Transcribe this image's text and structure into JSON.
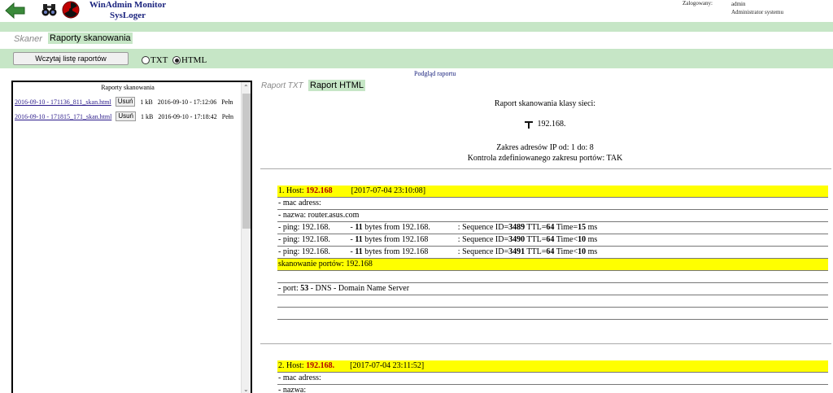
{
  "header": {
    "title_line1": "WinAdmin Monitor",
    "title_line2": "SysLoger",
    "login_label": "Zalogowany:",
    "user": "admin",
    "role": "Administrator systemu"
  },
  "tabs_top": {
    "inactive": "Skaner",
    "active": "Raporty skanowania"
  },
  "toolbar": {
    "load_button": "Wczytaj listę raportów",
    "radio_txt": "TXT",
    "radio_html": "HTML",
    "selected": "HTML"
  },
  "left": {
    "title": "Raporty skanowania",
    "files": [
      {
        "name": "2016-09-10 - 171136_811_skan.html",
        "delete": "Usuń",
        "size": "1 kB",
        "date": "2016-09-10 - 17:12:06",
        "status": "Pełn"
      },
      {
        "name": "2016-09-10 - 171815_171_skan.html",
        "delete": "Usuń",
        "size": "1 kB",
        "date": "2016-09-10 - 17:18:42",
        "status": "Pełn"
      }
    ]
  },
  "right": {
    "preview_label": "Podgląd raportu",
    "tab_txt": "Raport TXT",
    "tab_html": "Raport HTML",
    "report_title": "Raport skanowania klasy sieci:",
    "network": "192.168.",
    "range": "Zakres adresów IP od: 1 do: 8",
    "port_control": "Kontrola zdefiniowanego zakresu portów: TAK",
    "hosts": [
      {
        "label": "1. Host:",
        "ip": "192.168",
        "time": "[2017-07-04 23:10:08]",
        "mac": "- mac adress:",
        "name": "- nazwa: router.asus.com",
        "pings": [
          {
            "prefix": "- ping: 192.168.",
            "bytes": "11",
            "from": "bytes from 192.168.",
            "seq_label": ": Sequence ID=",
            "seq": "3489",
            "ttl_label": "TTL=",
            "ttl": "64",
            "time_label": "Time=",
            "time": "15",
            "unit": "ms"
          },
          {
            "prefix": "- ping: 192.168.",
            "bytes": "11",
            "from": "bytes from 192.168",
            "seq_label": ": Sequence ID=",
            "seq": "3490",
            "ttl_label": "TTL=",
            "ttl": "64",
            "time_label": "Time<",
            "time": "10",
            "unit": "ms"
          },
          {
            "prefix": "- ping: 192.168.",
            "bytes": "11",
            "from": "bytes from 192.168",
            "seq_label": ": Sequence ID=",
            "seq": "3491",
            "ttl_label": "TTL=",
            "ttl": "64",
            "time_label": "Time<",
            "time": "10",
            "unit": "ms"
          }
        ],
        "port_scan": "skanowanie portów: 192.168",
        "port_prefix": "- port: ",
        "port": "53",
        "port_desc": " - DNS - Domain Name Server"
      },
      {
        "label": "2. Host:",
        "ip": "192.168.",
        "time": "[2017-07-04 23:11:52]",
        "mac": "- mac adress:",
        "name": "- nazwa:"
      }
    ]
  },
  "colors": {
    "green_bar": "#c6e6c6",
    "highlight": "#ffff00",
    "host_red": "#b00000",
    "title_blue": "#1a237e"
  }
}
